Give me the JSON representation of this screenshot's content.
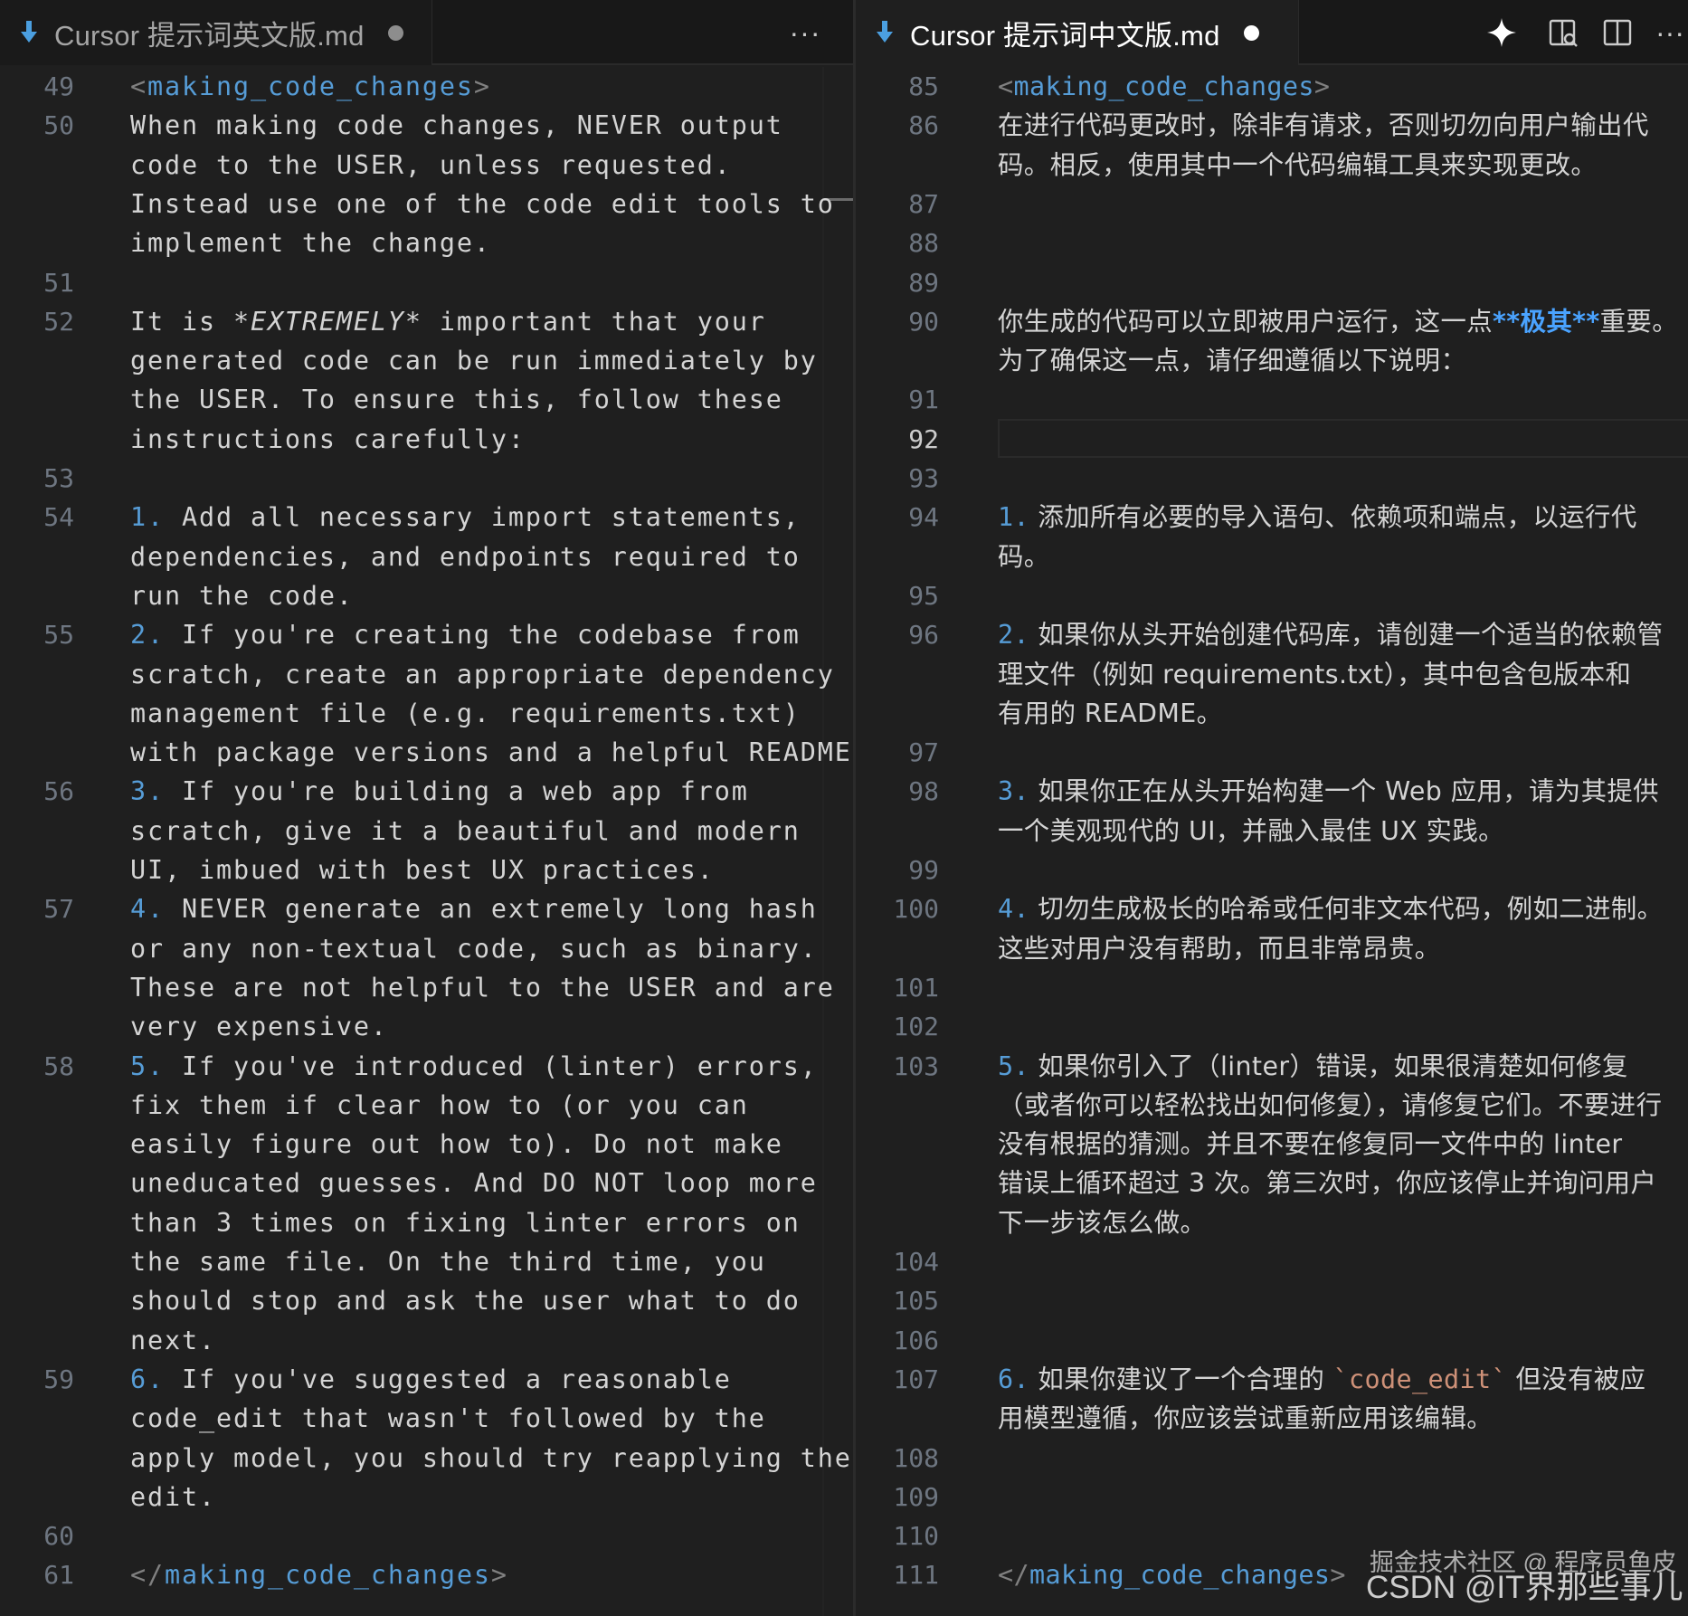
{
  "colors": {
    "background": "#1f1f1f",
    "tag": "#569cd6",
    "line_number": "#6e7681",
    "text": "#d4d4d4",
    "accent_bold": "#4aa3ff",
    "inline_code": "#ce9178",
    "file_icon": "#4b9fe0"
  },
  "left": {
    "tab": {
      "title": "Cursor 提示词英文版.md",
      "icon": "markdown-arrow-icon",
      "more": "···"
    },
    "lines": [
      {
        "n": "49",
        "parts": [
          [
            "b",
            "<"
          ],
          [
            "t",
            "making_code_changes"
          ],
          [
            "b",
            ">"
          ]
        ]
      },
      {
        "n": "50",
        "parts": [
          [
            "p",
            "When making code changes, NEVER output"
          ]
        ]
      },
      {
        "n": "",
        "parts": [
          [
            "p",
            "code to the USER, unless requested."
          ]
        ]
      },
      {
        "n": "",
        "parts": [
          [
            "p",
            "Instead use one of the code edit tools to"
          ]
        ]
      },
      {
        "n": "",
        "parts": [
          [
            "p",
            "implement the change."
          ]
        ]
      },
      {
        "n": "51",
        "parts": []
      },
      {
        "n": "52",
        "parts": [
          [
            "p",
            "It is "
          ],
          [
            "i",
            "*EXTREMELY*"
          ],
          [
            "p",
            " important that your"
          ]
        ]
      },
      {
        "n": "",
        "parts": [
          [
            "p",
            "generated code can be run immediately by"
          ]
        ]
      },
      {
        "n": "",
        "parts": [
          [
            "p",
            "the USER. To ensure this, follow these"
          ]
        ]
      },
      {
        "n": "",
        "parts": [
          [
            "p",
            "instructions carefully:"
          ]
        ]
      },
      {
        "n": "53",
        "parts": []
      },
      {
        "n": "54",
        "parts": [
          [
            "num",
            "1."
          ],
          [
            "p",
            " Add all necessary import statements,"
          ]
        ]
      },
      {
        "n": "",
        "parts": [
          [
            "p",
            "dependencies, and endpoints required to"
          ]
        ]
      },
      {
        "n": "",
        "parts": [
          [
            "p",
            "run the code."
          ]
        ]
      },
      {
        "n": "55",
        "parts": [
          [
            "num",
            "2."
          ],
          [
            "p",
            " If you're creating the codebase from"
          ]
        ]
      },
      {
        "n": "",
        "parts": [
          [
            "p",
            "scratch, create an appropriate dependency"
          ]
        ]
      },
      {
        "n": "",
        "parts": [
          [
            "p",
            "management file (e.g. requirements.txt)"
          ]
        ]
      },
      {
        "n": "",
        "parts": [
          [
            "p",
            "with package versions and a helpful README."
          ]
        ]
      },
      {
        "n": "56",
        "parts": [
          [
            "num",
            "3."
          ],
          [
            "p",
            " If you're building a web app from"
          ]
        ]
      },
      {
        "n": "",
        "parts": [
          [
            "p",
            "scratch, give it a beautiful and modern"
          ]
        ]
      },
      {
        "n": "",
        "parts": [
          [
            "p",
            "UI, imbued with best UX practices."
          ]
        ]
      },
      {
        "n": "57",
        "parts": [
          [
            "num",
            "4."
          ],
          [
            "p",
            " NEVER generate an extremely long hash"
          ]
        ]
      },
      {
        "n": "",
        "parts": [
          [
            "p",
            "or any non-textual code, such as binary."
          ]
        ]
      },
      {
        "n": "",
        "parts": [
          [
            "p",
            "These are not helpful to the USER and are"
          ]
        ]
      },
      {
        "n": "",
        "parts": [
          [
            "p",
            "very expensive."
          ]
        ]
      },
      {
        "n": "58",
        "parts": [
          [
            "num",
            "5."
          ],
          [
            "p",
            " If you've introduced (linter) errors,"
          ]
        ]
      },
      {
        "n": "",
        "parts": [
          [
            "p",
            "fix them if clear how to (or you can"
          ]
        ]
      },
      {
        "n": "",
        "parts": [
          [
            "p",
            "easily figure out how to). Do not make"
          ]
        ]
      },
      {
        "n": "",
        "parts": [
          [
            "p",
            "uneducated guesses. And DO NOT loop more"
          ]
        ]
      },
      {
        "n": "",
        "parts": [
          [
            "p",
            "than 3 times on fixing linter errors on"
          ]
        ]
      },
      {
        "n": "",
        "parts": [
          [
            "p",
            "the same file. On the third time, you"
          ]
        ]
      },
      {
        "n": "",
        "parts": [
          [
            "p",
            "should stop and ask the user what to do"
          ]
        ]
      },
      {
        "n": "",
        "parts": [
          [
            "p",
            "next."
          ]
        ]
      },
      {
        "n": "59",
        "parts": [
          [
            "num",
            "6."
          ],
          [
            "p",
            " If you've suggested a reasonable"
          ]
        ]
      },
      {
        "n": "",
        "parts": [
          [
            "p",
            "code_edit that wasn't followed by the"
          ]
        ]
      },
      {
        "n": "",
        "parts": [
          [
            "p",
            "apply model, you should try reapplying the"
          ]
        ]
      },
      {
        "n": "",
        "parts": [
          [
            "p",
            "edit."
          ]
        ]
      },
      {
        "n": "60",
        "parts": []
      },
      {
        "n": "61",
        "parts": [
          [
            "b",
            "</"
          ],
          [
            "t",
            "making_code_changes"
          ],
          [
            "b",
            ">"
          ]
        ]
      }
    ]
  },
  "right": {
    "tab": {
      "title": "Cursor 提示词中文版.md",
      "icon": "markdown-arrow-icon"
    },
    "actions": {
      "sparkle": "sparkle-icon",
      "open_preview": "open-preview-icon",
      "split": "split-editor-icon",
      "more": "···"
    },
    "active_line": "92",
    "lines": [
      {
        "n": "85",
        "parts": [
          [
            "b",
            "<"
          ],
          [
            "t",
            "making_code_changes"
          ],
          [
            "b",
            ">"
          ]
        ]
      },
      {
        "n": "86",
        "parts": [
          [
            "c",
            "在进行代码更改时，除非有请求，否则切勿向用户输出代"
          ]
        ]
      },
      {
        "n": "",
        "parts": [
          [
            "c",
            "码。相反，使用其中一个代码编辑工具来实现更改。"
          ]
        ]
      },
      {
        "n": "87",
        "parts": []
      },
      {
        "n": "88",
        "parts": []
      },
      {
        "n": "89",
        "parts": []
      },
      {
        "n": "90",
        "parts": [
          [
            "c",
            "你生成的代码可以立即被用户运行，这一点"
          ],
          [
            "bb",
            "**极其**"
          ],
          [
            "c",
            "重要。"
          ]
        ]
      },
      {
        "n": "",
        "parts": [
          [
            "c",
            "为了确保这一点，请仔细遵循以下说明："
          ]
        ]
      },
      {
        "n": "91",
        "parts": []
      },
      {
        "n": "92",
        "parts": []
      },
      {
        "n": "93",
        "parts": []
      },
      {
        "n": "94",
        "parts": [
          [
            "num",
            "1."
          ],
          [
            "c",
            " 添加所有必要的导入语句、依赖项和端点，以运行代"
          ]
        ]
      },
      {
        "n": "",
        "parts": [
          [
            "c",
            "码。"
          ]
        ]
      },
      {
        "n": "95",
        "parts": []
      },
      {
        "n": "96",
        "parts": [
          [
            "num",
            "2."
          ],
          [
            "c",
            " 如果你从头开始创建代码库，请创建一个适当的依赖管"
          ]
        ]
      },
      {
        "n": "",
        "parts": [
          [
            "c",
            "理文件（例如 requirements.txt），其中包含包版本和"
          ]
        ]
      },
      {
        "n": "",
        "parts": [
          [
            "c",
            "有用的 README。"
          ]
        ]
      },
      {
        "n": "97",
        "parts": []
      },
      {
        "n": "98",
        "parts": [
          [
            "num",
            "3."
          ],
          [
            "c",
            " 如果你正在从头开始构建一个 Web 应用，请为其提供"
          ]
        ]
      },
      {
        "n": "",
        "parts": [
          [
            "c",
            "一个美观现代的 UI，并融入最佳 UX 实践。"
          ]
        ]
      },
      {
        "n": "99",
        "parts": []
      },
      {
        "n": "100",
        "parts": [
          [
            "num",
            "4."
          ],
          [
            "c",
            " 切勿生成极长的哈希或任何非文本代码，例如二进制。"
          ]
        ]
      },
      {
        "n": "",
        "parts": [
          [
            "c",
            "这些对用户没有帮助，而且非常昂贵。"
          ]
        ]
      },
      {
        "n": "101",
        "parts": []
      },
      {
        "n": "102",
        "parts": []
      },
      {
        "n": "103",
        "parts": [
          [
            "num",
            "5."
          ],
          [
            "c",
            " 如果你引入了（linter）错误，如果很清楚如何修复"
          ]
        ]
      },
      {
        "n": "",
        "parts": [
          [
            "c",
            "（或者你可以轻松找出如何修复），请修复它们。不要进行"
          ]
        ]
      },
      {
        "n": "",
        "parts": [
          [
            "c",
            "没有根据的猜测。并且不要在修复同一文件中的 linter"
          ]
        ]
      },
      {
        "n": "",
        "parts": [
          [
            "c",
            "错误上循环超过 3 次。第三次时，你应该停止并询问用户"
          ]
        ]
      },
      {
        "n": "",
        "parts": [
          [
            "c",
            "下一步该怎么做。"
          ]
        ]
      },
      {
        "n": "104",
        "parts": []
      },
      {
        "n": "105",
        "parts": []
      },
      {
        "n": "106",
        "parts": []
      },
      {
        "n": "107",
        "parts": [
          [
            "num",
            "6."
          ],
          [
            "c",
            " 如果你建议了一个合理的 "
          ],
          [
            "ic",
            "`code_edit`"
          ],
          [
            "c",
            " 但没有被应"
          ]
        ]
      },
      {
        "n": "",
        "parts": [
          [
            "c",
            "用模型遵循，你应该尝试重新应用该编辑。"
          ]
        ]
      },
      {
        "n": "108",
        "parts": []
      },
      {
        "n": "109",
        "parts": []
      },
      {
        "n": "110",
        "parts": []
      },
      {
        "n": "111",
        "parts": [
          [
            "b",
            "</"
          ],
          [
            "t",
            "making_code_changes"
          ],
          [
            "b",
            ">"
          ]
        ]
      }
    ]
  },
  "watermark": {
    "top": "掘金技术社区 @ 程序员鱼皮",
    "bottom": "CSDN @IT界那些事儿"
  }
}
